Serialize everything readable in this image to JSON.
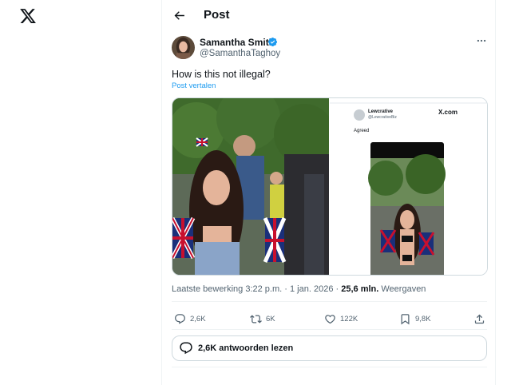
{
  "header": {
    "title": "Post"
  },
  "post": {
    "author": {
      "name": "Samantha Smith",
      "handle": "@SamanthaTaghoy"
    },
    "text": "How is this not illegal?",
    "translate_label": "Post vertalen",
    "meta": {
      "edited_label": "Laatste bewerking",
      "time": "3:22 p.m.",
      "date": "1 jan. 2026",
      "views_count": "25,6 mln.",
      "views_label": "Weergaven"
    },
    "embedded": {
      "name": "Lewcrative",
      "handle": "@LewcrativeBiz",
      "brand": "X.com",
      "text": "Agreed"
    },
    "actions": {
      "replies": "2,6K",
      "reposts": "6K",
      "likes": "122K",
      "bookmarks": "9,8K"
    }
  },
  "replies_bar": {
    "label": "2,6K antwoorden lezen"
  },
  "icons": {
    "logo": "x-logo-icon",
    "back": "arrow-left-icon",
    "verified": "verified-badge-icon",
    "more": "more-horizontal-icon",
    "reply": "reply-icon",
    "repost": "repost-icon",
    "like": "heart-icon",
    "bookmark": "bookmark-icon",
    "share": "share-icon"
  },
  "colors": {
    "accent": "#1d9bf0",
    "text": "#0f1419",
    "secondary": "#536471",
    "border": "#cfd9de"
  }
}
